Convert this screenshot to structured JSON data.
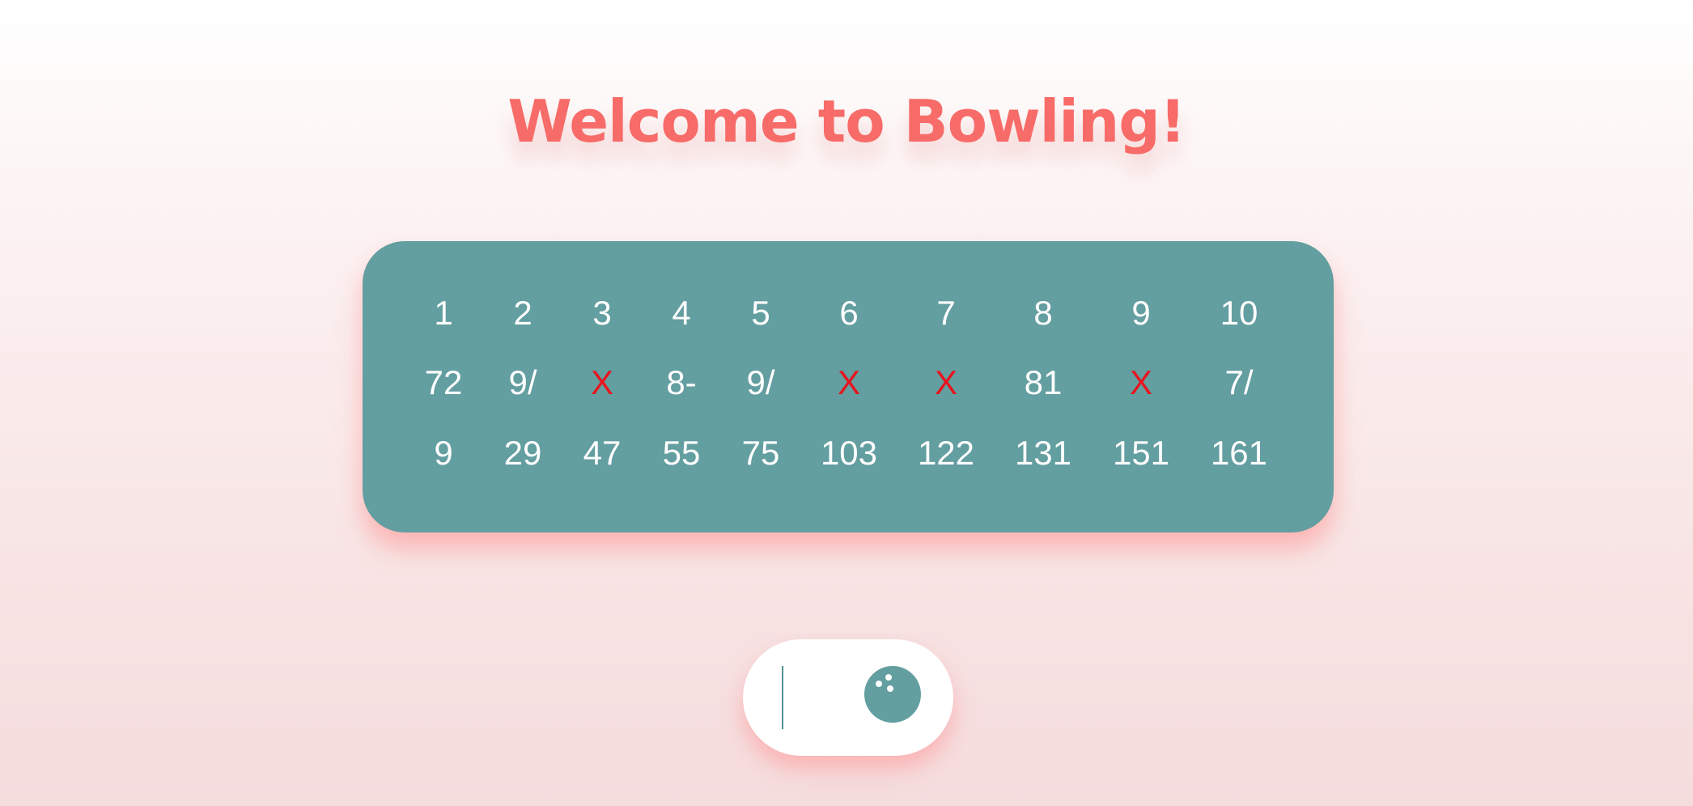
{
  "app": {
    "title": "Welcome to Bowling!"
  },
  "scorecard": {
    "frames": [
      "1",
      "2",
      "3",
      "4",
      "5",
      "6",
      "7",
      "8",
      "9",
      "10"
    ],
    "rolls": [
      "72",
      "9/",
      "X",
      "8-",
      "9/",
      "X",
      "X",
      "81",
      "X",
      "7/"
    ],
    "scores": [
      "9",
      "29",
      "47",
      "55",
      "75",
      "103",
      "122",
      "131",
      "151",
      "161"
    ]
  },
  "roll_input": {
    "value": "",
    "icon": "bowling-ball-icon"
  },
  "colors": {
    "title": "#f76b68",
    "card": "#639ea0",
    "strike": "#e8141e",
    "text": "#ffffff"
  }
}
